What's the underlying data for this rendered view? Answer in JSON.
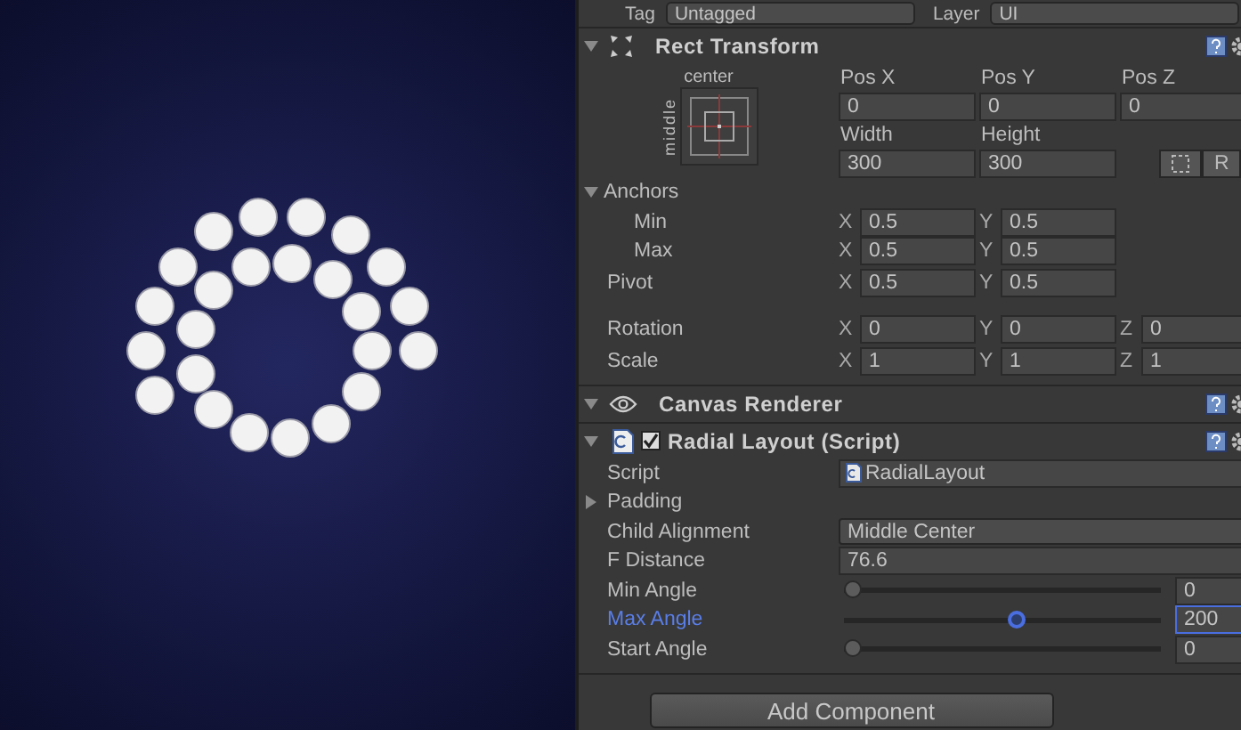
{
  "game_view": {
    "kind": "radial_preview"
  },
  "inspector_header": {
    "tag_label": "Tag",
    "tag_value": "Untagged",
    "layer_label": "Layer",
    "layer_value": "UI"
  },
  "rect_transform": {
    "title": "Rect Transform",
    "expanded": true,
    "anchor_horizontal": "center",
    "anchor_vertical": "middle",
    "position": [
      {
        "label": "Pos X",
        "value": "0"
      },
      {
        "label": "Pos Y",
        "value": "0"
      },
      {
        "label": "Pos Z",
        "value": "0"
      }
    ],
    "size": [
      {
        "label": "Width",
        "value": "300"
      },
      {
        "label": "Height",
        "value": "300"
      }
    ],
    "raw_button": "R",
    "anchors": {
      "label": "Anchors",
      "expanded": true,
      "children": [
        {
          "label": "Min",
          "fields": [
            {
              "axis": "X",
              "value": "0.5"
            },
            {
              "axis": "Y",
              "value": "0.5"
            }
          ]
        },
        {
          "label": "Max",
          "fields": [
            {
              "axis": "X",
              "value": "0.5"
            },
            {
              "axis": "Y",
              "value": "0.5"
            }
          ]
        }
      ]
    },
    "rows": [
      {
        "label": "Pivot",
        "fields": [
          {
            "axis": "X",
            "value": "0.5"
          },
          {
            "axis": "Y",
            "value": "0.5"
          }
        ]
      },
      {
        "label": "Rotation",
        "fields": [
          {
            "axis": "X",
            "value": "0"
          },
          {
            "axis": "Y",
            "value": "0"
          },
          {
            "axis": "Z",
            "value": "0"
          }
        ]
      },
      {
        "label": "Scale",
        "fields": [
          {
            "axis": "X",
            "value": "1"
          },
          {
            "axis": "Y",
            "value": "1"
          },
          {
            "axis": "Z",
            "value": "1"
          }
        ]
      }
    ]
  },
  "canvas_renderer": {
    "title": "Canvas Renderer",
    "expanded": true
  },
  "radial_layout": {
    "title": "Radial Layout (Script)",
    "expanded": true,
    "enabled": true,
    "properties": [
      {
        "kind": "object",
        "label": "Script",
        "value": "RadialLayout"
      },
      {
        "kind": "foldout",
        "label": "Padding",
        "expanded": false
      },
      {
        "kind": "dropdown",
        "label": "Child Alignment",
        "value": "Middle Center"
      },
      {
        "kind": "number",
        "label": "F Distance",
        "value": "76.6"
      },
      {
        "kind": "slider",
        "label": "Min Angle",
        "level": 0,
        "value": "0",
        "focused": false
      },
      {
        "kind": "slider",
        "label": "Max Angle",
        "level": 0.55,
        "value": "200",
        "focused": true
      },
      {
        "kind": "slider",
        "label": "Start Angle",
        "level": 0,
        "value": "0",
        "focused": false
      }
    ]
  },
  "add_component_button": "Add Component"
}
